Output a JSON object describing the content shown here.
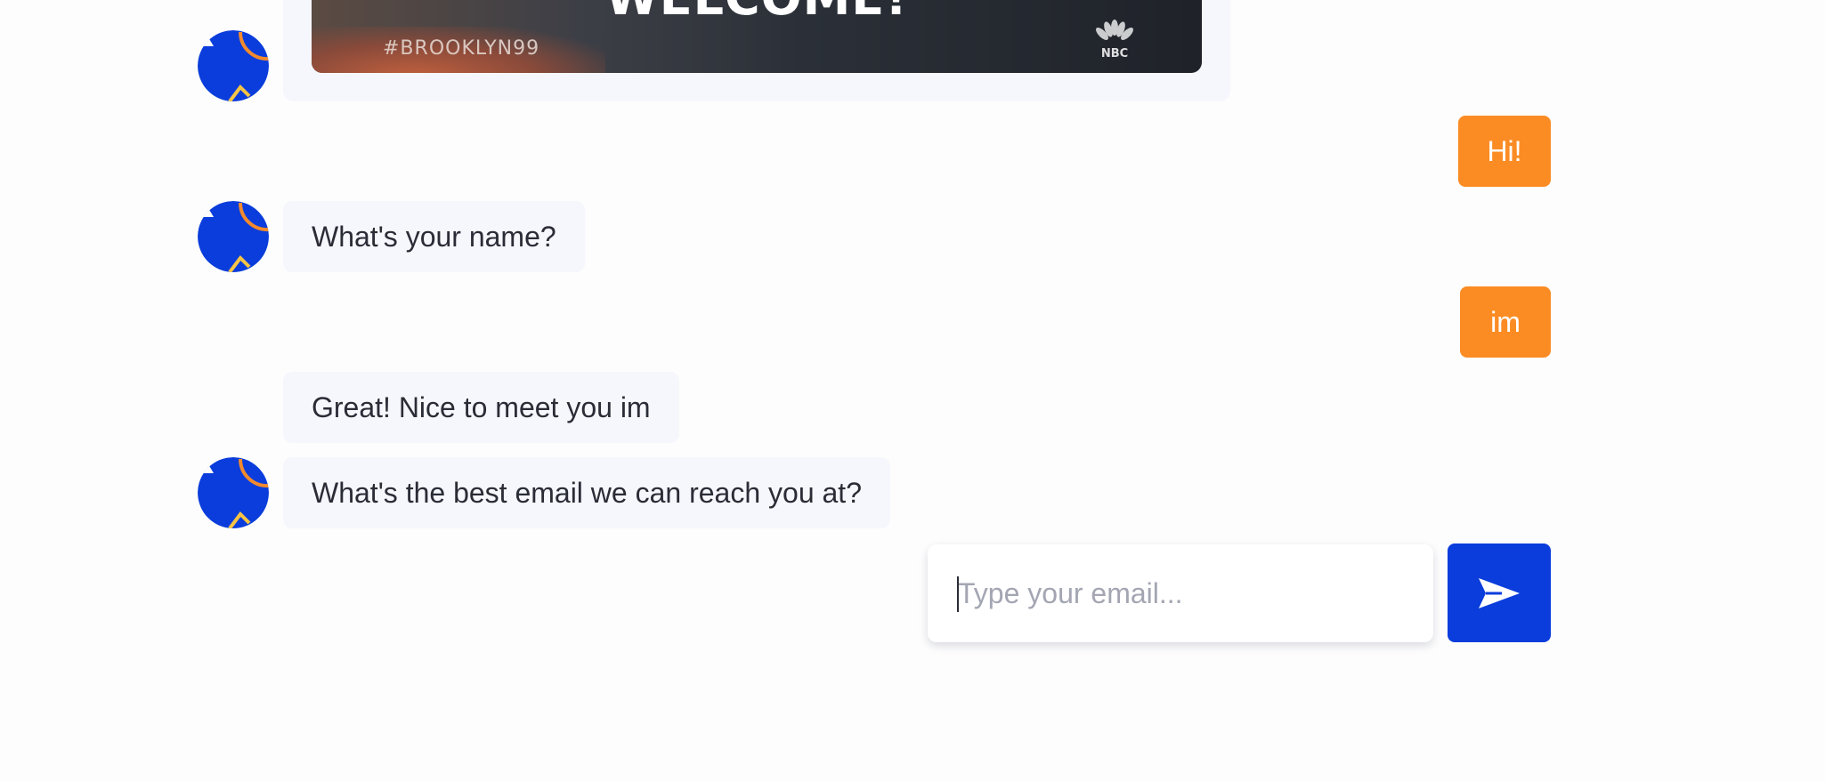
{
  "gif": {
    "title_text": "WELCOME!",
    "hashtag": "#BROOKLYN99",
    "network_logo": "NBC"
  },
  "messages": [
    {
      "from": "user",
      "text": "Hi!"
    },
    {
      "from": "bot",
      "text": "What's your name?"
    },
    {
      "from": "user",
      "text": "im"
    },
    {
      "from": "bot",
      "text": "Great! Nice to meet you im"
    },
    {
      "from": "bot",
      "text": "What's the best email we can reach you at?"
    }
  ],
  "composer": {
    "placeholder": "Type your email...",
    "send_icon": "send-arrow-icon"
  },
  "colors": {
    "bot_avatar": "#0a3ddb",
    "user_bubble": "#fb8c24",
    "bot_bubble": "#f6f7fc",
    "send_button": "#0a3ddb"
  }
}
